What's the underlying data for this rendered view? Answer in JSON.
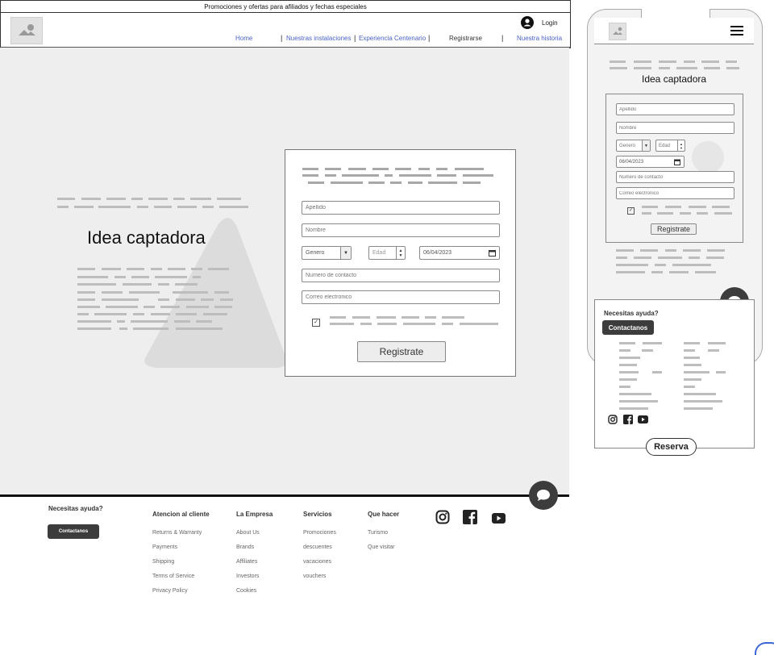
{
  "promo_strip": "Promociones y ofertas para afiliados y fechas especiales",
  "header": {
    "login_label": "Login",
    "nav": [
      {
        "label": "Home"
      },
      {
        "label": "Nuestras instalaciones"
      },
      {
        "label": "Experiencia Centenario"
      },
      {
        "label": "Registrarse"
      },
      {
        "label": "Nuestra historia"
      }
    ]
  },
  "hero": {
    "headline": "Idea captadora"
  },
  "form": {
    "apellido_placeholder": "Apellido",
    "nombre_placeholder": "Nombre",
    "genero_value": "Genero",
    "edad_placeholder": "Edad",
    "date_value": "06/04/2023",
    "contacto_placeholder": "Numero de contacto",
    "correo_placeholder": "Correo electronico",
    "submit_label": "Registrate"
  },
  "footer": {
    "help_title": "Necesitas ayuda?",
    "contact_button": "Contactanos",
    "columns": [
      {
        "title": "Atencion al cliente",
        "items": [
          "Returns & Warranty",
          "Payments",
          "Shipping",
          "Terms of Service",
          "Privacy Policy"
        ]
      },
      {
        "title": "La Empresa",
        "items": [
          "About Us",
          "Brands",
          "Affiliates",
          "Investors",
          "Cookies"
        ]
      },
      {
        "title": "Servicios",
        "items": [
          "Promociones",
          "descuentes",
          "vacaciones",
          "vouchers"
        ]
      },
      {
        "title": "Que hacer",
        "items": [
          "Turismo",
          "Que visitar"
        ]
      }
    ],
    "social_icons": [
      "instagram-icon",
      "facebook-icon",
      "youtube-icon"
    ]
  },
  "mobile": {
    "headline": "Idea captadora",
    "form": {
      "apellido_placeholder": "Apellido",
      "nombre_placeholder": "Nombre",
      "genero_value": "Genero",
      "edad_placeholder": "Edad",
      "date_value": "06/04/2023",
      "contacto_placeholder": "Numero de contacto",
      "correo_placeholder": "Correo electronico",
      "submit_label": "Registrate"
    },
    "help_title": "Necesitas ayuda?",
    "contact_button": "Contactanos",
    "reserva_button": "Reserva"
  },
  "colors": {
    "link": "#4a63c8",
    "dark_button": "#3c3c3c",
    "hero_bg": "#eeeeee"
  }
}
